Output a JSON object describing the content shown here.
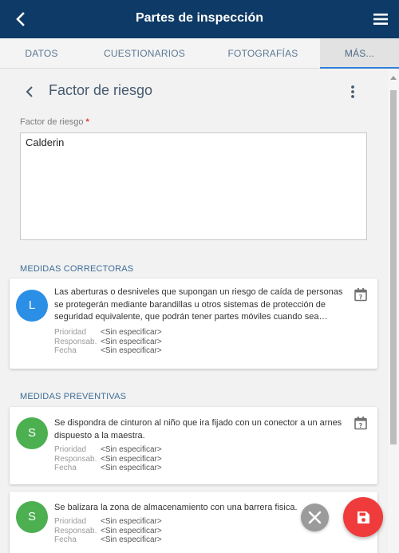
{
  "appbar": {
    "title": "Partes de inspección"
  },
  "tabs": [
    {
      "label": "DATOS"
    },
    {
      "label": "CUESTIONARIOS"
    },
    {
      "label": "FOTOGRAFÍAS"
    },
    {
      "label": "MÁS..."
    }
  ],
  "section": {
    "title": "Factor de riesgo"
  },
  "field": {
    "label": "Factor de riesgo",
    "required_mark": "*",
    "value": "Calderin"
  },
  "meta_labels": {
    "priority": "Prioridad",
    "responsible": "Responsab.",
    "date": "Fecha"
  },
  "correctoras": {
    "title": "MEDIDAS CORRECTORAS",
    "items": [
      {
        "avatar": "L",
        "avatar_color": "#2b8fe6",
        "text": "Las aberturas o desniveles que supongan un riesgo de caída de personas se protegerán mediante barandillas u otros sistemas de protección de seguridad equivalente, que podrán tener partes móviles cuando sea…",
        "priority": "<Sin especificar>",
        "responsible": "<Sin especificar>",
        "date": "<Sin especificar>"
      }
    ]
  },
  "preventivas": {
    "title": "MEDIDAS PREVENTIVAS",
    "items": [
      {
        "avatar": "S",
        "avatar_color": "#4caf50",
        "text": "Se dispondra de cinturon al niño que ira fijado con un conector a un arnes dispuesto a la maestra.",
        "priority": "<Sin especificar>",
        "responsible": "<Sin especificar>",
        "date": "<Sin especificar>"
      },
      {
        "avatar": "S",
        "avatar_color": "#4caf50",
        "text": "Se balizara la zona de almacenamiento con una barrera fisica.",
        "priority": "<Sin especificar>",
        "responsible": "<Sin especificar>",
        "date": "<Sin especificar>"
      }
    ]
  },
  "colors": {
    "appbar": "#0d3a66",
    "accent": "#2f7ed8",
    "save_fab": "#ef3b3b",
    "cancel_fab": "#9b9b9b"
  }
}
